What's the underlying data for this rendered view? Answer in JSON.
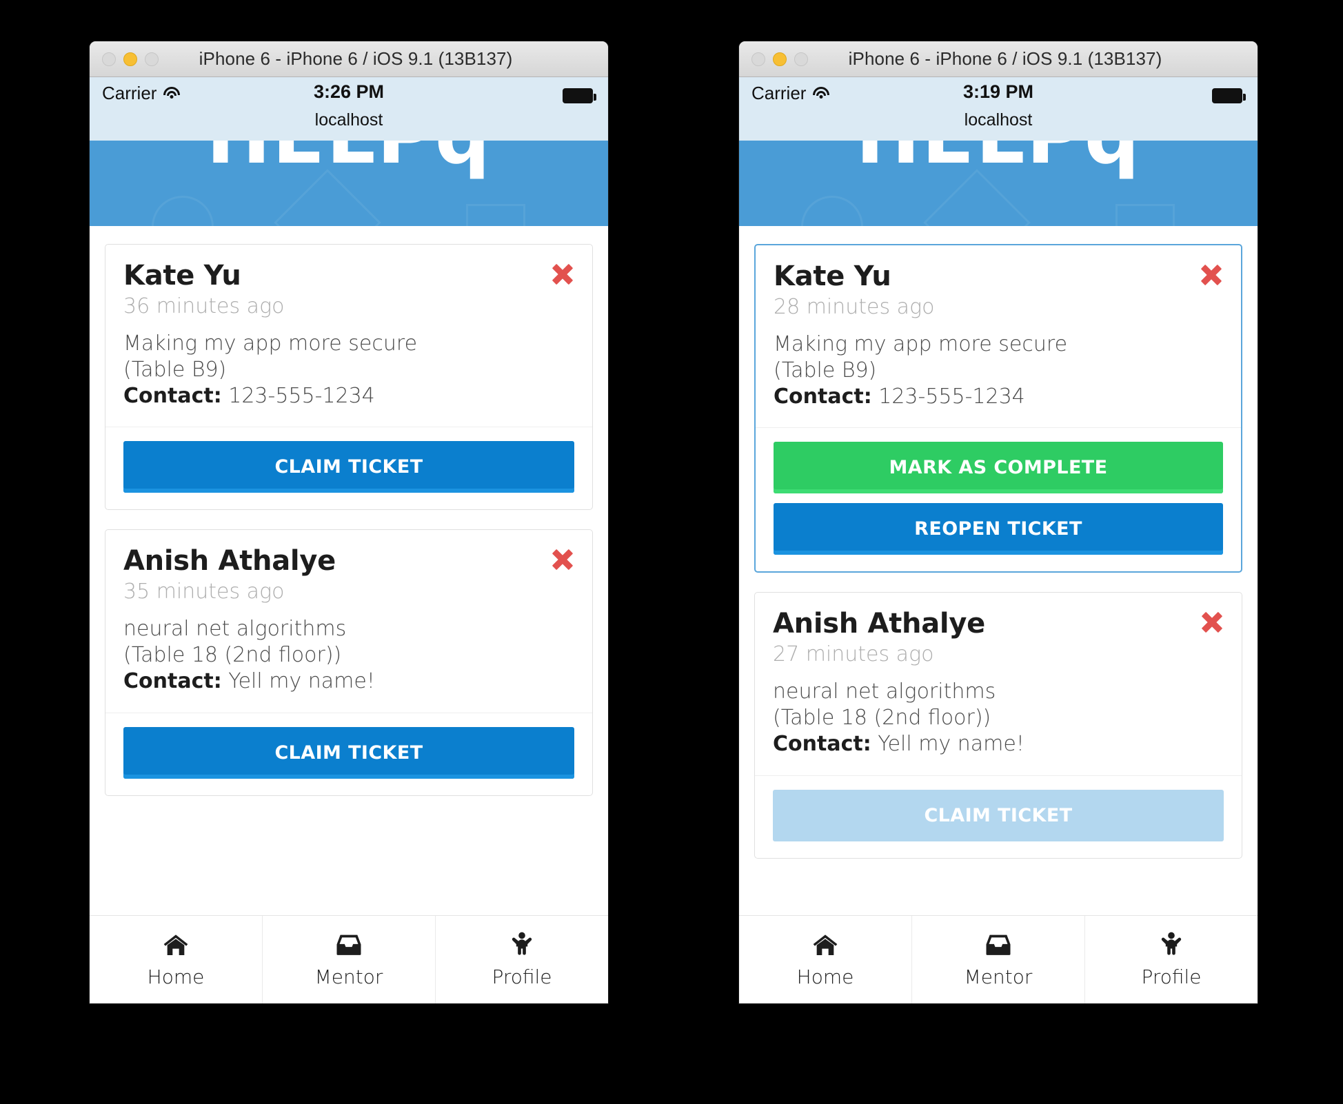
{
  "windows": [
    {
      "id": "left",
      "window_title": "iPhone 6 - iPhone 6 / iOS 9.1 (13B137)",
      "status": {
        "carrier": "Carrier",
        "wifi_icon": "wifi-icon",
        "time": "3:26 PM",
        "host": "localhost",
        "battery_icon": "battery-icon"
      },
      "app_header": {
        "logo": "HELPq"
      },
      "cards": [
        {
          "name": "Kate Yu",
          "time": "36 minutes ago",
          "description": "Making my app more secure",
          "location": "(Table B9)",
          "contact_label": "Contact:",
          "contact_value": "123-555-1234",
          "close_icon": "close-icon",
          "active": false,
          "buttons": [
            {
              "label": "CLAIM TICKET",
              "style": "blue"
            }
          ]
        },
        {
          "name": "Anish Athalye",
          "time": "35 minutes ago",
          "description": "neural net algorithms",
          "location": "(Table 18 (2nd floor))",
          "contact_label": "Contact:",
          "contact_value": "Yell my name!",
          "close_icon": "close-icon",
          "active": false,
          "buttons": [
            {
              "label": "CLAIM TICKET",
              "style": "blue"
            }
          ]
        }
      ],
      "tabs": [
        {
          "label": "Home",
          "icon": "home-icon"
        },
        {
          "label": "Mentor",
          "icon": "inbox-icon"
        },
        {
          "label": "Profile",
          "icon": "person-icon"
        }
      ]
    },
    {
      "id": "right",
      "window_title": "iPhone 6 - iPhone 6 / iOS 9.1 (13B137)",
      "status": {
        "carrier": "Carrier",
        "wifi_icon": "wifi-icon",
        "time": "3:19 PM",
        "host": "localhost",
        "battery_icon": "battery-icon"
      },
      "app_header": {
        "logo": "HELPq"
      },
      "cards": [
        {
          "name": "Kate Yu",
          "time": "28 minutes ago",
          "description": "Making my app more secure",
          "location": "(Table B9)",
          "contact_label": "Contact:",
          "contact_value": "123-555-1234",
          "close_icon": "close-icon",
          "active": true,
          "buttons": [
            {
              "label": "MARK AS COMPLETE",
              "style": "green"
            },
            {
              "label": "REOPEN TICKET",
              "style": "blue"
            }
          ]
        },
        {
          "name": "Anish Athalye",
          "time": "27 minutes ago",
          "description": "neural net algorithms",
          "location": "(Table 18 (2nd floor))",
          "contact_label": "Contact:",
          "contact_value": "Yell my name!",
          "close_icon": "close-icon",
          "active": false,
          "buttons": [
            {
              "label": "CLAIM TICKET",
              "style": "disabled"
            }
          ]
        }
      ],
      "tabs": [
        {
          "label": "Home",
          "icon": "home-icon"
        },
        {
          "label": "Mentor",
          "icon": "inbox-icon"
        },
        {
          "label": "Profile",
          "icon": "person-icon"
        }
      ]
    }
  ],
  "colors": {
    "app_header_blue": "#4a9cd6",
    "primary_blue": "#0b7fce",
    "success_green": "#2ecc63",
    "disabled_blue": "#b3d7ef",
    "close_red": "#e2514e",
    "status_bar": "#dbeaf4",
    "active_card_border": "#5aa6db"
  }
}
